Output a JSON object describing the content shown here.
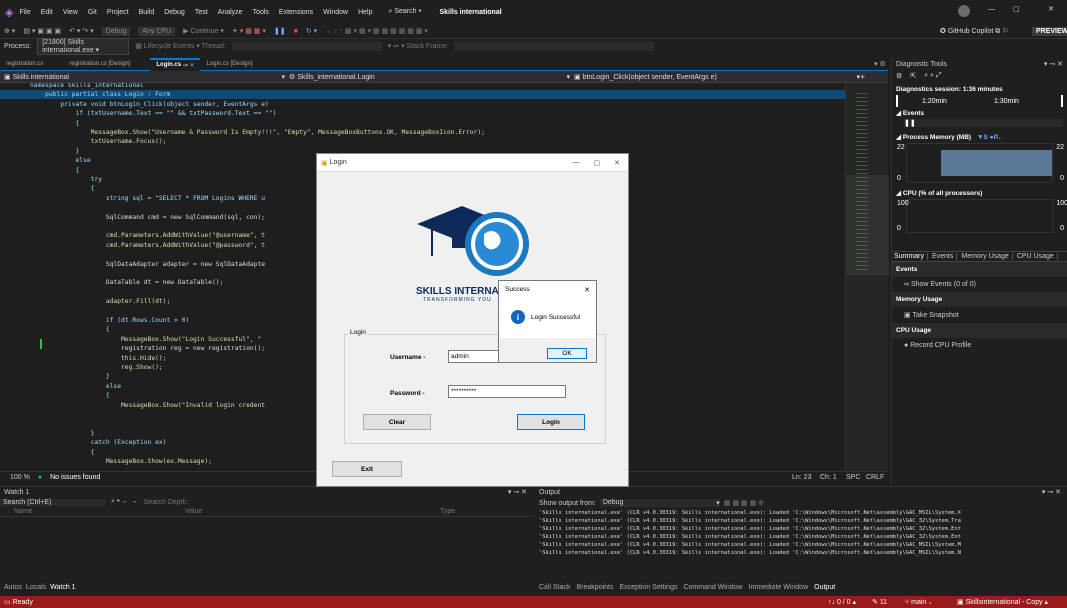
{
  "app": {
    "menu": [
      "File",
      "Edit",
      "View",
      "Git",
      "Project",
      "Build",
      "Debug",
      "Test",
      "Analyze",
      "Tools",
      "Extensions",
      "Window",
      "Help"
    ],
    "search": "Search",
    "solution": "Skills international",
    "copilot": "GitHub Copilot",
    "preview": "PREVIEW"
  },
  "toolbar": {
    "debug": "Debug",
    "cpu": "Any CPU",
    "continue": "Continue",
    "process_label": "Process:",
    "process_value": "[21800] Skills international.exe",
    "lifecycle": "Lifecycle Events",
    "thread": "Thread:",
    "stackframe": "Stack Frame:"
  },
  "tabs": [
    "registration.cs",
    "registration.cs [Design]",
    "Login.cs",
    "Login.cs [Design]"
  ],
  "nav": {
    "project": "Skills international",
    "class": "Skills_international.Login",
    "member": "btnLogin_Click(object sender, EventArgs e)"
  },
  "code": [
    "namespace Skills_international",
    "    public partial class Login : Form",
    "        private void btnLogin_Click(object sender, EventArgs e)",
    "            if (txtUsername.Text == \"\" && txtPassword.Text == \"\")",
    "            {",
    "                MessageBox.Show(\"Username & Password Is Empty!!!\", \"Empty\", MessageBoxButtons.OK, MessageBoxIcon.Error);",
    "                txtUsername.Focus();",
    "            }",
    "            else",
    "            {",
    "                try",
    "                {",
    "                    string sql = \"SELECT * FROM Logins WHERE u",
    "",
    "                    SqlCommand cmd = new SqlCommand(sql, con);",
    "",
    "                    cmd.Parameters.AddWithValue(\"@username\", t",
    "                    cmd.Parameters.AddWithValue(\"@password\", t",
    "",
    "                    SqlDataAdapter adapter = new SqlDataAdapte",
    "",
    "                    DataTable dt = new DataTable();",
    "",
    "                    adapter.Fill(dt);",
    "",
    "                    if (dt.Rows.Count > 0)",
    "                    {",
    "                        MessageBox.Show(\"Login Successful\", \"",
    "                        registration reg = new registration();",
    "                        this.Hide();",
    "                        reg.Show();",
    "                    }",
    "                    else",
    "                    {",
    "                        MessageBox.Show(\"Invalid login credent",
    "",
    "",
    "                }",
    "                catch (Exception ex)",
    "                {",
    "                    MessageBox.Show(ex.Message);"
  ],
  "editor_status": {
    "zoom": "100 %",
    "issues": "No issues found",
    "ln": "Ln: 23",
    "ch": "Ch: 1",
    "spc": "SPC",
    "crlf": "CRLF"
  },
  "diag": {
    "title": "Diagnostic Tools",
    "session": "Diagnostics session: 1:36 minutes",
    "t1": "1:20min",
    "t2": "1:30min",
    "events": "Events",
    "process_memory": "Process Memory (MB)",
    "mem_legend": "▼S  ●P..",
    "mem_max": "22",
    "mem_min": "0",
    "cpu": "CPU (% of all processors)",
    "cpu_max": "100",
    "cpu_min": "0",
    "tabs": [
      "Summary",
      "Events",
      "Memory Usage",
      "CPU Usage"
    ],
    "events_h": "Events",
    "show_events": "Show Events (0 of 0)",
    "memory_usage": "Memory Usage",
    "take_snapshot": "Take Snapshot",
    "cpu_usage": "CPU Usage",
    "record_cpu": "Record CPU Profile"
  },
  "watch": {
    "title": "Watch 1",
    "search": "Search (Ctrl+E)",
    "depth": "Search Depth:",
    "cols": [
      "Name",
      "Value",
      "Type"
    ],
    "bottom_tabs": [
      "Autos",
      "Locals",
      "Watch 1"
    ]
  },
  "output": {
    "title": "Output",
    "show_from": "Show output from:",
    "source": "Debug",
    "lines": [
      "'Skills international.exe' (CLR v4.0.30319: Skills international.exe): Loaded 'C:\\Windows\\Microsoft.Net\\assembly\\GAC_MSIL\\System.X",
      "'Skills international.exe' (CLR v4.0.30319: Skills international.exe): Loaded 'C:\\Windows\\Microsoft.Net\\assembly\\GAC_32\\System.Tra",
      "'Skills international.exe' (CLR v4.0.30319: Skills international.exe): Loaded 'C:\\Windows\\Microsoft.Net\\assembly\\GAC_32\\System.Ent",
      "'Skills international.exe' (CLR v4.0.30319: Skills international.exe): Loaded 'C:\\Windows\\Microsoft.Net\\assembly\\GAC_32\\System.Ent",
      "'Skills international.exe' (CLR v4.0.30319: Skills international.exe): Loaded 'C:\\Windows\\Microsoft.Net\\assembly\\GAC_MSIL\\System.M",
      "'Skills international.exe' (CLR v4.0.30319: Skills international.exe): Loaded 'C:\\Windows\\Microsoft.Net\\assembly\\GAC_MSIL\\System.N"
    ],
    "bottom_tabs": [
      "Call Stack",
      "Breakpoints",
      "Exception Settings",
      "Command Window",
      "Immediate Window",
      "Output"
    ]
  },
  "status": {
    "ready": "Ready",
    "errors": "↑↓ 0 / 0 ▴",
    "edits": "11",
    "branch": "main ▴",
    "repo": "Skillsinternational - Copy ▴"
  },
  "login": {
    "title": "Login",
    "logo_text": "SKILLS INTERNA",
    "tagline": "TRANSFORMING YOU",
    "group": "Login",
    "username_label": "Username -",
    "username_value": "admin",
    "password_label": "Password -",
    "password_value": "**********",
    "clear": "Clear",
    "login": "Login",
    "exit": "Exit"
  },
  "success": {
    "title": "Success",
    "message": "Login Successful",
    "ok": "OK"
  }
}
